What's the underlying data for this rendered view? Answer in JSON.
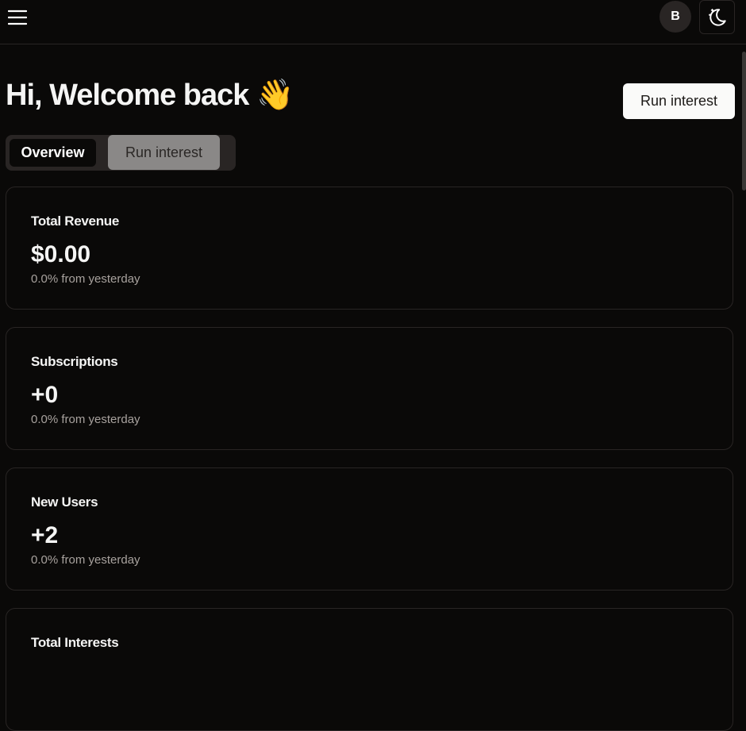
{
  "header": {
    "avatar_initial": "B",
    "menu_icon": "hamburger-icon",
    "theme_icon": "moon-stars-icon"
  },
  "main": {
    "greeting": "Hi, Welcome back 👋",
    "run_button": "Run interest",
    "tabs": [
      {
        "label": "Overview",
        "active": true
      },
      {
        "label": "Run interest",
        "active": false
      }
    ],
    "cards": [
      {
        "title": "Total Revenue",
        "value": "$0.00",
        "sub": "0.0% from yesterday"
      },
      {
        "title": "Subscriptions",
        "value": "+0",
        "sub": "0.0% from yesterday"
      },
      {
        "title": "New Users",
        "value": "+2",
        "sub": "0.0% from yesterday"
      },
      {
        "title": "Total Interests"
      }
    ]
  }
}
